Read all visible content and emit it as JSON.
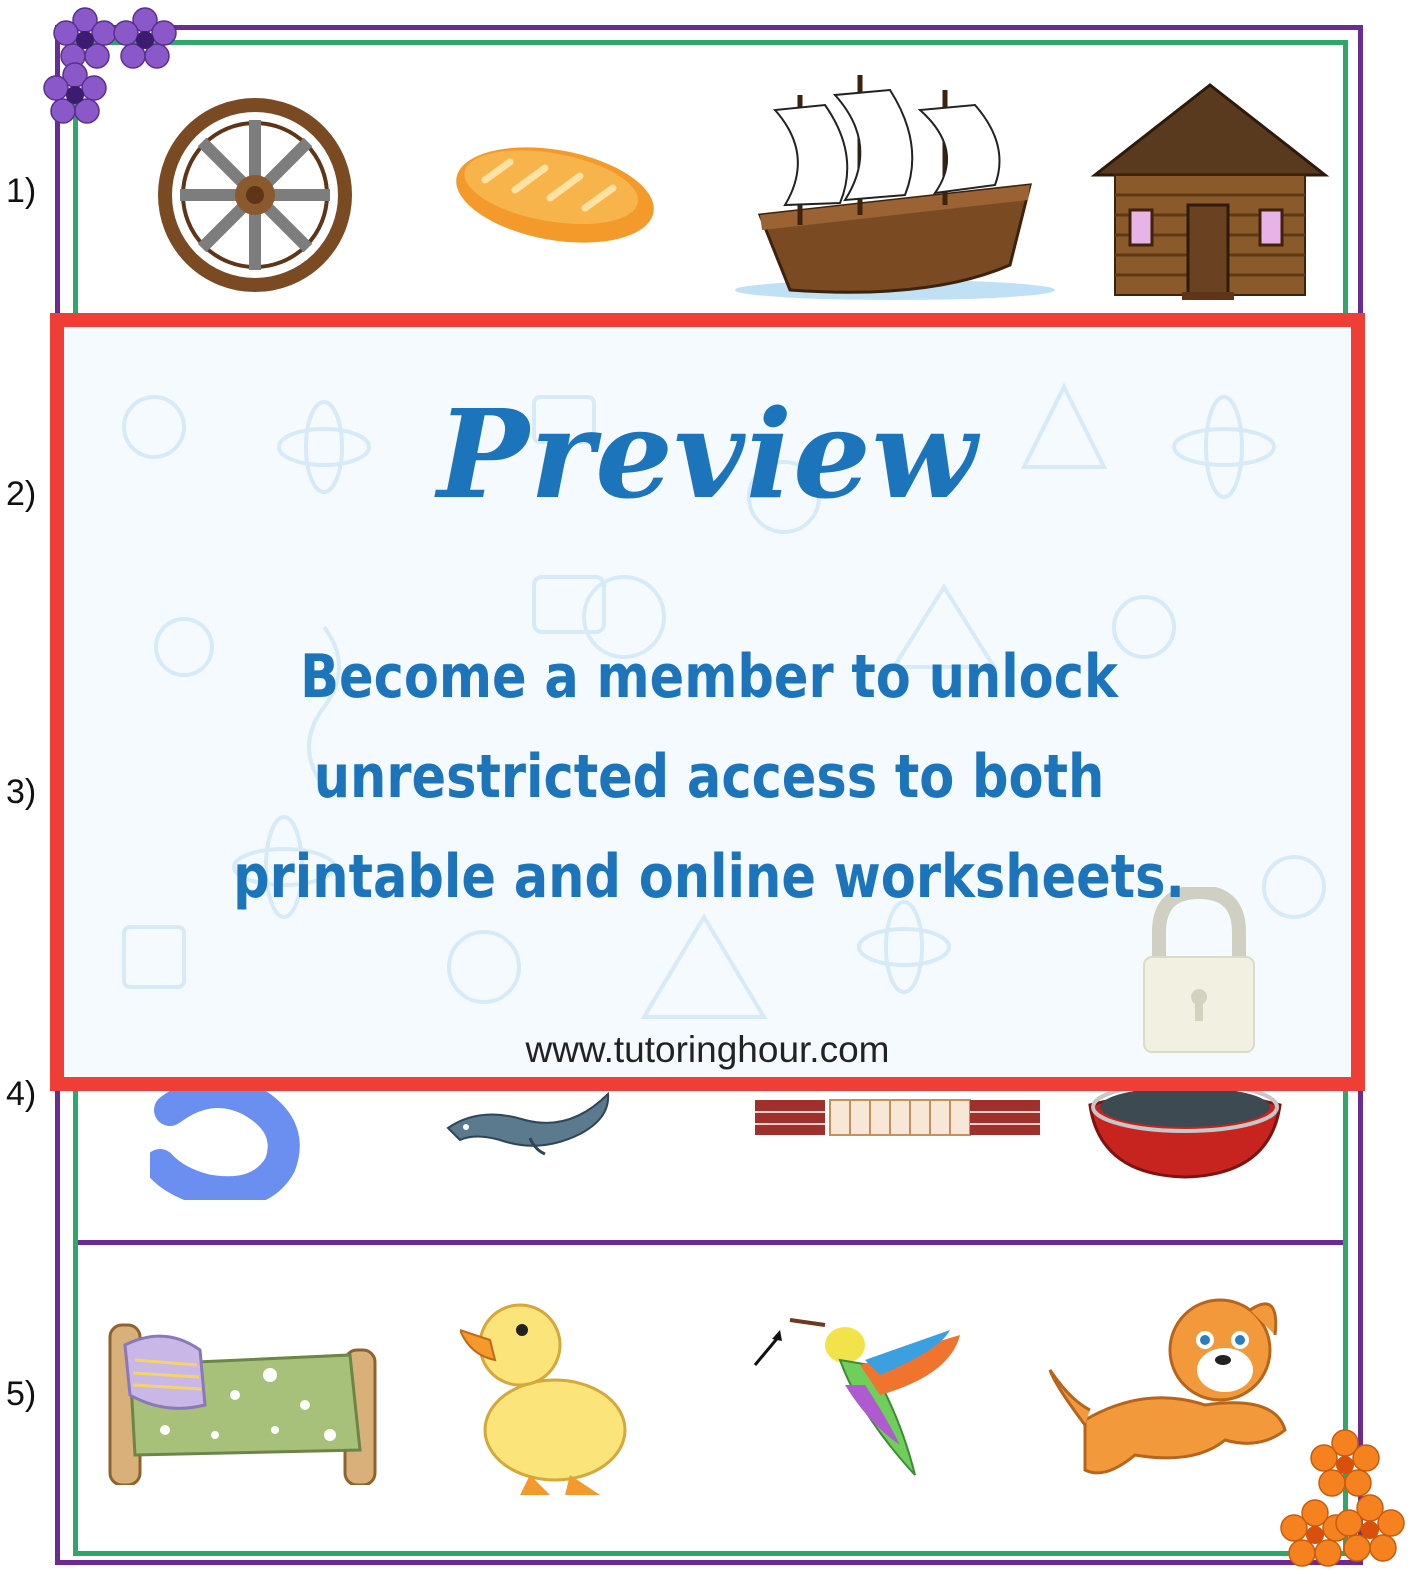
{
  "rows": [
    {
      "number": "1)",
      "images": [
        "wheel",
        "bread",
        "ship",
        "house"
      ]
    },
    {
      "number": "2)",
      "images": []
    },
    {
      "number": "3)",
      "images": []
    },
    {
      "number": "4)",
      "images": [
        "number-5",
        "eel",
        "wall",
        "pan"
      ]
    },
    {
      "number": "5)",
      "images": [
        "bed",
        "duck",
        "hummingbird",
        "puppy"
      ]
    }
  ],
  "overlay": {
    "title": "Preview",
    "message": "Become a member to unlock unrestricted access to both printable and online worksheets.",
    "url": "www.tutoringhour.com"
  },
  "colors": {
    "outer_border": "#6a2c93",
    "inner_border": "#2fa66a",
    "overlay_border": "#ee3e36",
    "accent_text": "#1c74bb",
    "corner_flowers_top": "#8a58c8",
    "corner_flowers_bottom": "#f5821f"
  }
}
